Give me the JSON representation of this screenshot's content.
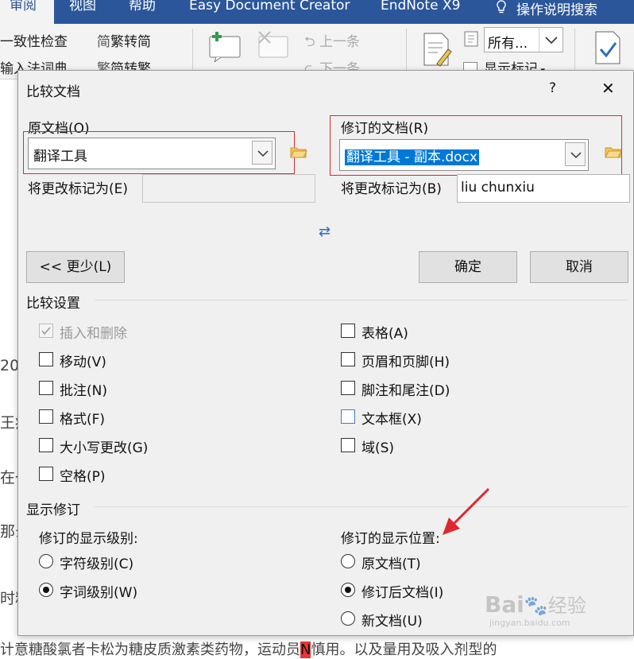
{
  "ribbon": {
    "tabs": [
      "审阅",
      "视图",
      "帮助",
      "Easy Document Creator",
      "EndNote X9",
      "操作说明搜索"
    ],
    "consistency_check": "一致性检查",
    "ime_dict": "输入法词典",
    "to_simplified": "繁转简",
    "to_traditional": "简转繁",
    "prev_comment": "上一条",
    "next_comment": "下一条",
    "markup_dropdown": "所有...",
    "show_markup": "显示标记"
  },
  "document": {
    "fragments": [
      "20",
      "王疾",
      "在一",
      "那么",
      "时糗",
      "计意糖酸氯者卡松为糖皮质激素类药物，运动员",
      "N",
      "慎用。以及量用及吸入剂型的"
    ]
  },
  "dialog": {
    "title": "比较文档",
    "help": "?",
    "close": "✕",
    "original_label": "原文档(O)",
    "original_value": "翻译工具",
    "revised_label": "修订的文档(R)",
    "revised_value": "翻译工具 - 副本.docx",
    "label_changes_left": "将更改标记为(E)",
    "label_changes_right": "将更改标记为(B)",
    "label_changes_right_value": "liu chunxiu",
    "swap_icon": "⇄",
    "less_button": "<< 更少(L)",
    "ok_button": "确定",
    "cancel_button": "取消",
    "settings_header": "比较设置",
    "settings": {
      "left": [
        {
          "label": "插入和删除",
          "checked": true,
          "disabled": true
        },
        {
          "label": "移动(V)",
          "checked": false
        },
        {
          "label": "批注(N)",
          "checked": false
        },
        {
          "label": "格式(F)",
          "checked": false
        },
        {
          "label": "大小写更改(G)",
          "checked": false
        },
        {
          "label": "空格(P)",
          "checked": false
        }
      ],
      "right": [
        {
          "label": "表格(A)",
          "checked": false
        },
        {
          "label": "页眉和页脚(H)",
          "checked": false
        },
        {
          "label": "脚注和尾注(D)",
          "checked": false
        },
        {
          "label": "文本框(X)",
          "checked": false
        },
        {
          "label": "域(S)",
          "checked": false
        }
      ]
    },
    "show_header": "显示修订",
    "level_label": "修订的显示级别:",
    "level_options": [
      {
        "label": "字符级别(C)",
        "selected": false
      },
      {
        "label": "字词级别(W)",
        "selected": true
      }
    ],
    "position_label": "修订的显示位置:",
    "position_options": [
      {
        "label": "原文档(T)",
        "selected": false
      },
      {
        "label": "修订后文档(I)",
        "selected": true
      },
      {
        "label": "新文档(U)",
        "selected": false
      }
    ]
  },
  "watermark": {
    "brand": "Bai",
    "brand2": "经验",
    "url": "jingyan.baidu.com"
  }
}
